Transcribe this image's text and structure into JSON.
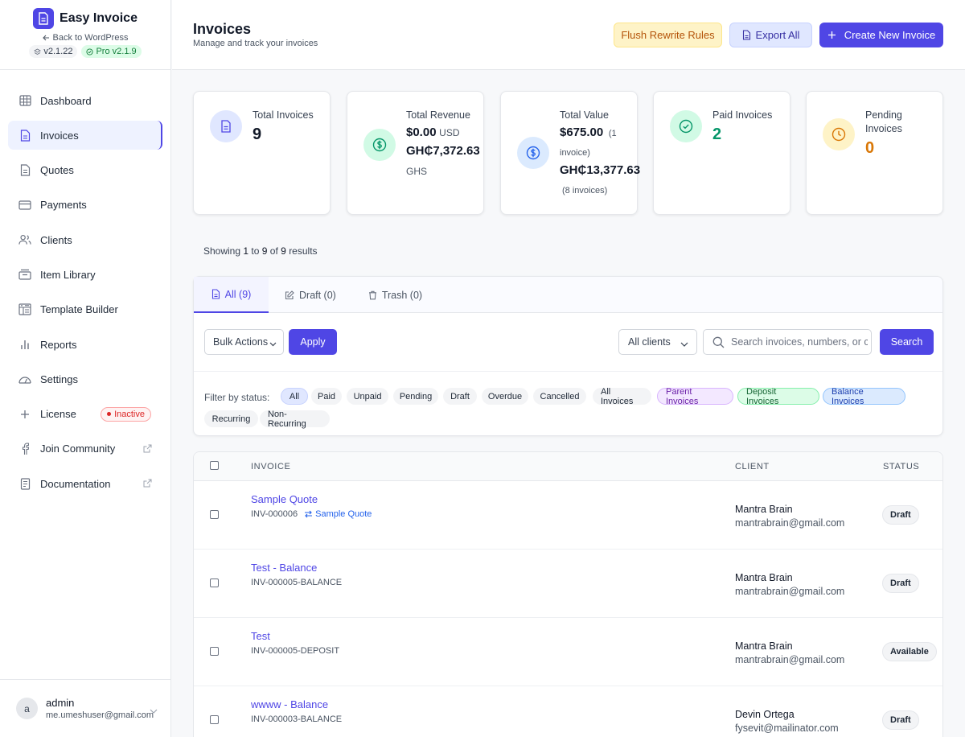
{
  "brand": {
    "title": "Easy Invoice",
    "back_label": "Back to WordPress",
    "version": "v2.1.22",
    "pro_version": "Pro v2.1.9",
    "accent": "#4f46e5"
  },
  "nav": [
    {
      "label": "Dashboard",
      "icon": "dashboard-icon",
      "active": false
    },
    {
      "label": "Invoices",
      "icon": "invoice-icon",
      "active": true
    },
    {
      "label": "Quotes",
      "icon": "quote-icon",
      "active": false
    },
    {
      "label": "Payments",
      "icon": "credit-card-icon",
      "active": false
    },
    {
      "label": "Clients",
      "icon": "users-icon",
      "active": false
    },
    {
      "label": "Item Library",
      "icon": "library-icon",
      "active": false
    },
    {
      "label": "Template Builder",
      "icon": "template-icon",
      "active": false
    },
    {
      "label": "Reports",
      "icon": "bar-chart-icon",
      "active": false
    },
    {
      "label": "Settings",
      "icon": "settings-icon",
      "active": false
    },
    {
      "label": "License",
      "icon": "plus-icon",
      "active": false,
      "badge": "Inactive"
    },
    {
      "label": "Join Community",
      "icon": "facebook-icon",
      "active": false,
      "external": true
    },
    {
      "label": "Documentation",
      "icon": "document-icon",
      "active": false,
      "external": true
    }
  ],
  "user": {
    "initial": "a",
    "name": "admin",
    "email": "me.umeshuser@gmail.com"
  },
  "header": {
    "title": "Invoices",
    "subtitle": "Manage and track your invoices",
    "flush_label": "Flush Rewrite Rules",
    "export_label": "Export All",
    "create_label": "Create New Invoice"
  },
  "stats": {
    "total_invoices": {
      "label": "Total Invoices",
      "value": "9"
    },
    "total_revenue": {
      "label": "Total Revenue",
      "usd_value": "$0.00",
      "usd_unit": "USD",
      "ghs_value": "GH₵7,372.63",
      "ghs_unit": "GHS"
    },
    "total_value": {
      "label": "Total Value",
      "usd_value": "$675.00",
      "usd_note_a": "(1",
      "usd_note_b": "invoice)",
      "ghs_value": "GH₵13,377.63",
      "ghs_note": "(8 invoices)"
    },
    "paid": {
      "label": "Paid Invoices",
      "value": "2",
      "color": "#059669"
    },
    "pending": {
      "label_a": "Pending",
      "label_b": "Invoices",
      "value": "0",
      "color": "#d97706"
    }
  },
  "showing": {
    "prefix": "Showing",
    "from": "1",
    "to_word": "to",
    "to": "9",
    "of_word": "of",
    "total": "9",
    "suffix": "results"
  },
  "tabs": [
    {
      "label": "All (9)",
      "icon": "document-icon",
      "active": true
    },
    {
      "label": "Draft (0)",
      "icon": "edit-icon",
      "active": false
    },
    {
      "label": "Trash (0)",
      "icon": "trash-icon",
      "active": false
    }
  ],
  "toolbar": {
    "bulk_label": "Bulk Actions",
    "apply_label": "Apply",
    "clients_label": "All clients",
    "search_placeholder": "Search invoices, numbers, or cl",
    "search_label": "Search"
  },
  "filters": {
    "label": "Filter by status:",
    "chips": [
      "All",
      "Paid",
      "Unpaid",
      "Pending",
      "Draft",
      "Overdue",
      "Cancelled",
      "All Invoices",
      "Parent Invoices",
      "Deposit Invoices",
      "Balance Invoices",
      "Recurring",
      "Non-Recurring"
    ],
    "selected": "All"
  },
  "table": {
    "headers": {
      "invoice": "INVOICE",
      "client": "CLIENT",
      "status": "STATUS"
    },
    "rows": [
      {
        "title": "Sample Quote",
        "number": "INV-000006",
        "linked": "Sample Quote",
        "client": "Mantra Brain",
        "email": "mantrabrain@gmail.com",
        "status": "Draft"
      },
      {
        "title": "Test - Balance",
        "number": "INV-000005-BALANCE",
        "linked": "",
        "client": "Mantra Brain",
        "email": "mantrabrain@gmail.com",
        "status": "Draft"
      },
      {
        "title": "Test",
        "number": "INV-000005-DEPOSIT",
        "linked": "",
        "client": "Mantra Brain",
        "email": "mantrabrain@gmail.com",
        "status": "Available"
      },
      {
        "title": "wwww - Balance",
        "number": "INV-000003-BALANCE",
        "linked": "",
        "client": "Devin Ortega",
        "email": "fysevit@mailinator.com",
        "status": "Draft"
      }
    ]
  }
}
